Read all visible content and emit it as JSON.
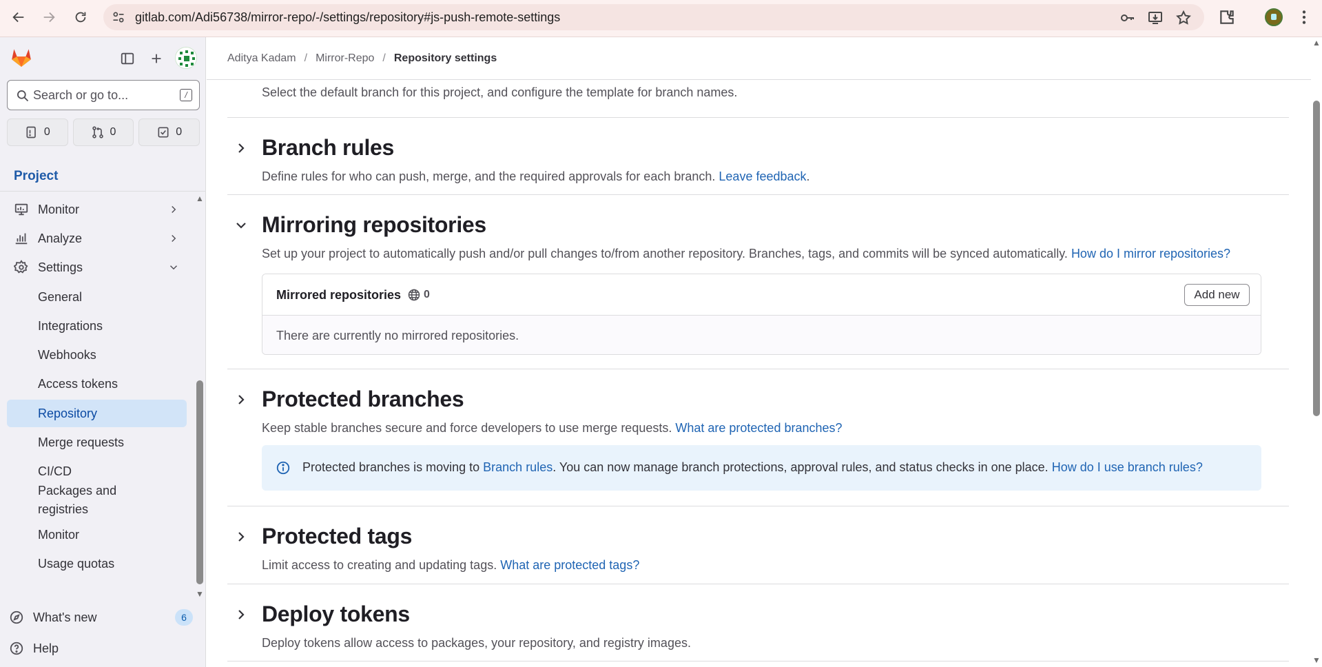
{
  "browser": {
    "url": "gitlab.com/Adi56738/mirror-repo/-/settings/repository#js-push-remote-settings",
    "icons": [
      "back-arrow-icon",
      "forward-arrow-icon",
      "reload-icon",
      "site-info-icon",
      "password-key-icon",
      "install-app-icon",
      "bookmark-star-icon",
      "extensions-icon",
      "profile-avatar",
      "kebab-menu-icon"
    ]
  },
  "sidebar": {
    "search_placeholder": "Search or go to...",
    "search_shortcut": "/",
    "counters": [
      {
        "icon": "issues-icon",
        "value": "0"
      },
      {
        "icon": "merge-request-icon",
        "value": "0"
      },
      {
        "icon": "todo-icon",
        "value": "0"
      }
    ],
    "context_label": "Project",
    "items": [
      {
        "label": "Monitor",
        "icon": "monitor-icon"
      },
      {
        "label": "Analyze",
        "icon": "chart-icon"
      },
      {
        "label": "Settings",
        "icon": "settings-icon"
      }
    ],
    "settings_subitems": [
      {
        "label": "General"
      },
      {
        "label": "Integrations"
      },
      {
        "label": "Webhooks"
      },
      {
        "label": "Access tokens"
      },
      {
        "label": "Repository"
      },
      {
        "label": "Merge requests"
      },
      {
        "label": "CI/CD"
      },
      {
        "label": "Packages and registries"
      },
      {
        "label": "Monitor"
      },
      {
        "label": "Usage quotas"
      }
    ],
    "whats_new": {
      "label": "What's new",
      "badge": "6"
    },
    "help": {
      "label": "Help"
    }
  },
  "breadcrumb": {
    "items": [
      "Aditya Kadam",
      "Mirror-Repo",
      "Repository settings"
    ]
  },
  "main": {
    "intro": "Select the default branch for this project, and configure the template for branch names.",
    "branch_rules": {
      "title": "Branch rules",
      "desc": "Define rules for who can push, merge, and the required approvals for each branch.",
      "link": "Leave feedback",
      "suffix": "."
    },
    "mirroring": {
      "title": "Mirroring repositories",
      "desc": "Set up your project to automatically push and/or pull changes to/from another repository. Branches, tags, and commits will be synced automatically.",
      "link": "How do I mirror repositories?",
      "card_title": "Mirrored repositories",
      "card_count": "0",
      "add_button": "Add new",
      "empty": "There are currently no mirrored repositories."
    },
    "protected_branches": {
      "title": "Protected branches",
      "desc": "Keep stable branches secure and force developers to use merge requests.",
      "link": "What are protected branches?",
      "alert_prefix": "Protected branches is moving to",
      "alert_link1": "Branch rules",
      "alert_middle": ". You can now manage branch protections, approval rules, and status checks in one place.",
      "alert_link2": "How do I use branch rules?"
    },
    "protected_tags": {
      "title": "Protected tags",
      "desc": "Limit access to creating and updating tags.",
      "link": "What are protected tags?"
    },
    "deploy_tokens": {
      "title": "Deploy tokens",
      "desc": "Deploy tokens allow access to packages, your repository, and registry images."
    }
  },
  "colors": {
    "link": "#1f64b3",
    "active_nav_bg": "#d2e4f8",
    "sidebar_bg": "#f1f0f5",
    "alert_bg": "#e9f3fc"
  }
}
